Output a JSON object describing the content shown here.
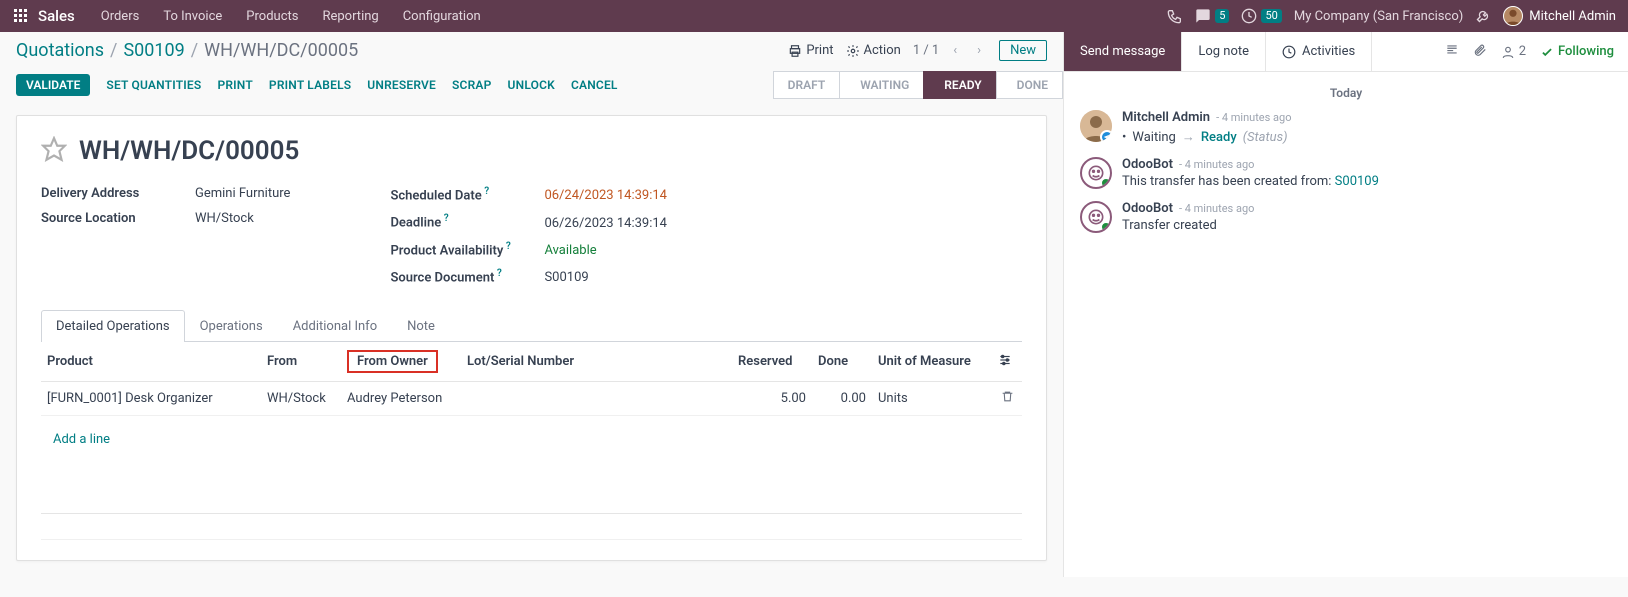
{
  "topbar": {
    "app": "Sales",
    "menu": [
      "Orders",
      "To Invoice",
      "Products",
      "Reporting",
      "Configuration"
    ],
    "chat_count": "5",
    "clock_count": "50",
    "company": "My Company (San Francisco)",
    "user": "Mitchell Admin"
  },
  "breadcrumb": {
    "root": "Quotations",
    "parent": "S00109",
    "current": "WH/WH/DC/00005"
  },
  "controls": {
    "print": "Print",
    "action": "Action",
    "pager": "1 / 1",
    "new": "New"
  },
  "actions": {
    "validate": "VALIDATE",
    "set_qty": "SET QUANTITIES",
    "print": "PRINT",
    "labels": "PRINT LABELS",
    "unreserve": "UNRESERVE",
    "scrap": "SCRAP",
    "unlock": "UNLOCK",
    "cancel": "CANCEL"
  },
  "status_steps": [
    "DRAFT",
    "WAITING",
    "READY",
    "DONE"
  ],
  "doc": {
    "title": "WH/WH/DC/00005",
    "delivery_address_label": "Delivery Address",
    "delivery_address": "Gemini Furniture",
    "source_location_label": "Source Location",
    "source_location": "WH/Stock",
    "scheduled_label": "Scheduled Date",
    "scheduled": "06/24/2023 14:39:14",
    "deadline_label": "Deadline",
    "deadline": "06/26/2023 14:39:14",
    "availability_label": "Product Availability",
    "availability": "Available",
    "source_doc_label": "Source Document",
    "source_doc": "S00109"
  },
  "tabs": [
    "Detailed Operations",
    "Operations",
    "Additional Info",
    "Note"
  ],
  "table": {
    "headers": {
      "product": "Product",
      "from": "From",
      "from_owner": "From Owner",
      "lot": "Lot/Serial Number",
      "reserved": "Reserved",
      "done": "Done",
      "uom": "Unit of Measure"
    },
    "rows": [
      {
        "product": "[FURN_0001] Desk Organizer",
        "from": "WH/Stock",
        "from_owner": "Audrey Peterson",
        "lot": "",
        "reserved": "5.00",
        "done": "0.00",
        "uom": "Units"
      }
    ],
    "add_line": "Add a line"
  },
  "chatter": {
    "send": "Send message",
    "log": "Log note",
    "activities": "Activities",
    "followers_count": "2",
    "following": "Following",
    "today": "Today",
    "messages": [
      {
        "author": "Mitchell Admin",
        "time": "- 4 minutes ago",
        "type": "status",
        "from": "Waiting",
        "to": "Ready",
        "status_label": "(Status)"
      },
      {
        "author": "OdooBot",
        "time": "- 4 minutes ago",
        "type": "text",
        "body_prefix": "This transfer has been created from: ",
        "link": "S00109"
      },
      {
        "author": "OdooBot",
        "time": "- 4 minutes ago",
        "type": "text",
        "body_prefix": "Transfer created",
        "link": ""
      }
    ]
  }
}
